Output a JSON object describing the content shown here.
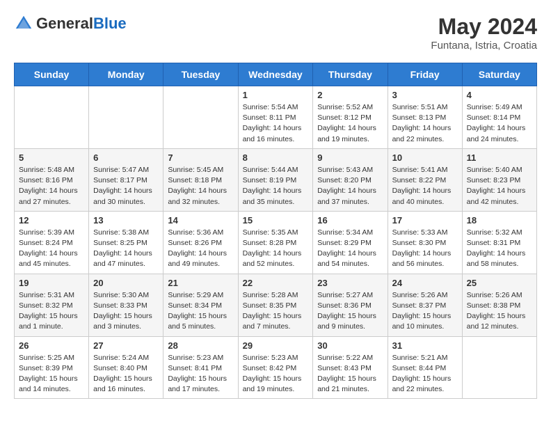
{
  "header": {
    "logo_general": "General",
    "logo_blue": "Blue",
    "month_year": "May 2024",
    "location": "Funtana, Istria, Croatia"
  },
  "columns": [
    "Sunday",
    "Monday",
    "Tuesday",
    "Wednesday",
    "Thursday",
    "Friday",
    "Saturday"
  ],
  "weeks": [
    [
      {
        "day": "",
        "info": ""
      },
      {
        "day": "",
        "info": ""
      },
      {
        "day": "",
        "info": ""
      },
      {
        "day": "1",
        "info": "Sunrise: 5:54 AM\nSunset: 8:11 PM\nDaylight: 14 hours and 16 minutes."
      },
      {
        "day": "2",
        "info": "Sunrise: 5:52 AM\nSunset: 8:12 PM\nDaylight: 14 hours and 19 minutes."
      },
      {
        "day": "3",
        "info": "Sunrise: 5:51 AM\nSunset: 8:13 PM\nDaylight: 14 hours and 22 minutes."
      },
      {
        "day": "4",
        "info": "Sunrise: 5:49 AM\nSunset: 8:14 PM\nDaylight: 14 hours and 24 minutes."
      }
    ],
    [
      {
        "day": "5",
        "info": "Sunrise: 5:48 AM\nSunset: 8:16 PM\nDaylight: 14 hours and 27 minutes."
      },
      {
        "day": "6",
        "info": "Sunrise: 5:47 AM\nSunset: 8:17 PM\nDaylight: 14 hours and 30 minutes."
      },
      {
        "day": "7",
        "info": "Sunrise: 5:45 AM\nSunset: 8:18 PM\nDaylight: 14 hours and 32 minutes."
      },
      {
        "day": "8",
        "info": "Sunrise: 5:44 AM\nSunset: 8:19 PM\nDaylight: 14 hours and 35 minutes."
      },
      {
        "day": "9",
        "info": "Sunrise: 5:43 AM\nSunset: 8:20 PM\nDaylight: 14 hours and 37 minutes."
      },
      {
        "day": "10",
        "info": "Sunrise: 5:41 AM\nSunset: 8:22 PM\nDaylight: 14 hours and 40 minutes."
      },
      {
        "day": "11",
        "info": "Sunrise: 5:40 AM\nSunset: 8:23 PM\nDaylight: 14 hours and 42 minutes."
      }
    ],
    [
      {
        "day": "12",
        "info": "Sunrise: 5:39 AM\nSunset: 8:24 PM\nDaylight: 14 hours and 45 minutes."
      },
      {
        "day": "13",
        "info": "Sunrise: 5:38 AM\nSunset: 8:25 PM\nDaylight: 14 hours and 47 minutes."
      },
      {
        "day": "14",
        "info": "Sunrise: 5:36 AM\nSunset: 8:26 PM\nDaylight: 14 hours and 49 minutes."
      },
      {
        "day": "15",
        "info": "Sunrise: 5:35 AM\nSunset: 8:28 PM\nDaylight: 14 hours and 52 minutes."
      },
      {
        "day": "16",
        "info": "Sunrise: 5:34 AM\nSunset: 8:29 PM\nDaylight: 14 hours and 54 minutes."
      },
      {
        "day": "17",
        "info": "Sunrise: 5:33 AM\nSunset: 8:30 PM\nDaylight: 14 hours and 56 minutes."
      },
      {
        "day": "18",
        "info": "Sunrise: 5:32 AM\nSunset: 8:31 PM\nDaylight: 14 hours and 58 minutes."
      }
    ],
    [
      {
        "day": "19",
        "info": "Sunrise: 5:31 AM\nSunset: 8:32 PM\nDaylight: 15 hours and 1 minute."
      },
      {
        "day": "20",
        "info": "Sunrise: 5:30 AM\nSunset: 8:33 PM\nDaylight: 15 hours and 3 minutes."
      },
      {
        "day": "21",
        "info": "Sunrise: 5:29 AM\nSunset: 8:34 PM\nDaylight: 15 hours and 5 minutes."
      },
      {
        "day": "22",
        "info": "Sunrise: 5:28 AM\nSunset: 8:35 PM\nDaylight: 15 hours and 7 minutes."
      },
      {
        "day": "23",
        "info": "Sunrise: 5:27 AM\nSunset: 8:36 PM\nDaylight: 15 hours and 9 minutes."
      },
      {
        "day": "24",
        "info": "Sunrise: 5:26 AM\nSunset: 8:37 PM\nDaylight: 15 hours and 10 minutes."
      },
      {
        "day": "25",
        "info": "Sunrise: 5:26 AM\nSunset: 8:38 PM\nDaylight: 15 hours and 12 minutes."
      }
    ],
    [
      {
        "day": "26",
        "info": "Sunrise: 5:25 AM\nSunset: 8:39 PM\nDaylight: 15 hours and 14 minutes."
      },
      {
        "day": "27",
        "info": "Sunrise: 5:24 AM\nSunset: 8:40 PM\nDaylight: 15 hours and 16 minutes."
      },
      {
        "day": "28",
        "info": "Sunrise: 5:23 AM\nSunset: 8:41 PM\nDaylight: 15 hours and 17 minutes."
      },
      {
        "day": "29",
        "info": "Sunrise: 5:23 AM\nSunset: 8:42 PM\nDaylight: 15 hours and 19 minutes."
      },
      {
        "day": "30",
        "info": "Sunrise: 5:22 AM\nSunset: 8:43 PM\nDaylight: 15 hours and 21 minutes."
      },
      {
        "day": "31",
        "info": "Sunrise: 5:21 AM\nSunset: 8:44 PM\nDaylight: 15 hours and 22 minutes."
      },
      {
        "day": "",
        "info": ""
      }
    ]
  ]
}
